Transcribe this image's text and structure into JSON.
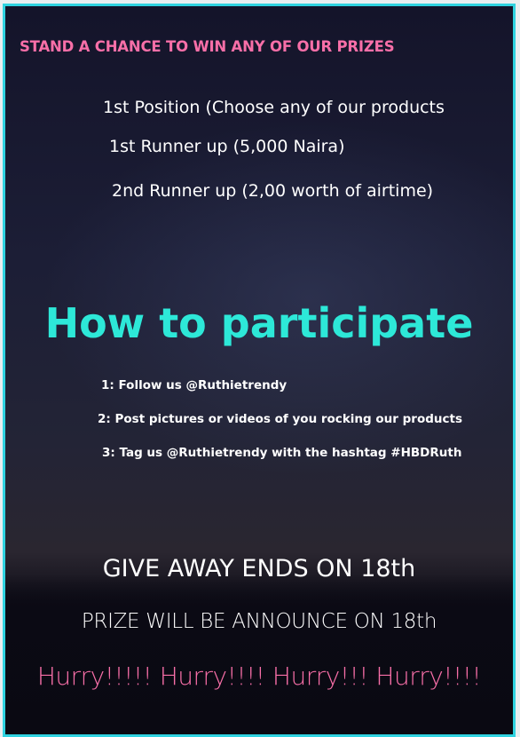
{
  "colors": {
    "border": "#2fd3e0",
    "pink": "#f86fa8",
    "cyan": "#2de8d8",
    "text": "#ffffff"
  },
  "headline": "STAND A CHANCE TO WIN ANY OF OUR PRIZES",
  "prizes": [
    "1st Position (Choose any of our products",
    "1st Runner up (5,000 Naira)",
    "2nd Runner up (2,00 worth of airtime)"
  ],
  "how_title": "How to participate",
  "steps": [
    "1: Follow us @Ruthietrendy",
    "2: Post pictures or videos of you rocking our products",
    "3: Tag us @Ruthietrendy with the hashtag #HBDRuth"
  ],
  "ends": "GIVE AWAY ENDS ON 18th",
  "announce": "PRIZE WILL BE ANNOUNCE ON 18th",
  "hurry": "Hurry!!!!!  Hurry!!!! Hurry!!!  Hurry!!!!"
}
